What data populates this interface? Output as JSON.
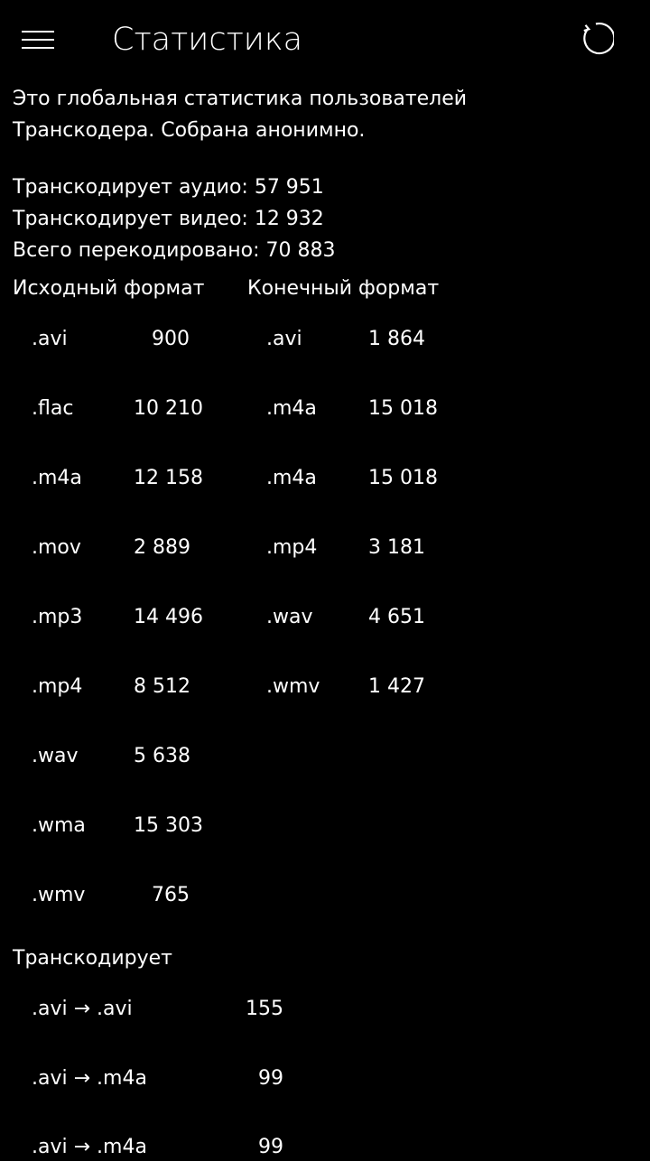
{
  "header": {
    "menu_icon": "hamburger-menu-icon",
    "title": "Статистика",
    "refresh_icon": "refresh-icon"
  },
  "intro": {
    "line1": "Это глобальная статистика пользователей",
    "line2": "Транскодера. Собрана анонимно."
  },
  "totals": {
    "audio": "Транскодирует аудио:  57 951",
    "video": "Транскодирует видео:  12 932",
    "all": "Всего перекодировано:  70 883"
  },
  "formats": {
    "source_header": "Исходный формат",
    "target_header": "Конечный формат",
    "source": [
      {
        "ext": ".avi",
        "count": "900"
      },
      {
        "ext": ".flac",
        "count": "10 210"
      },
      {
        "ext": ".m4a",
        "count": "12 158"
      },
      {
        "ext": ".mov",
        "count": "2 889"
      },
      {
        "ext": ".mp3",
        "count": "14 496"
      },
      {
        "ext": ".mp4",
        "count": "8 512"
      },
      {
        "ext": ".wav",
        "count": "5 638"
      },
      {
        "ext": ".wma",
        "count": "15 303"
      },
      {
        "ext": ".wmv",
        "count": "765"
      }
    ],
    "target": [
      {
        "ext": ".avi",
        "count": "1 864"
      },
      {
        "ext": ".m4a",
        "count": "15 018"
      },
      {
        "ext": ".m4a",
        "count": "15 018"
      },
      {
        "ext": ".mp4",
        "count": "3 181"
      },
      {
        "ext": ".wav",
        "count": "4 651"
      },
      {
        "ext": ".wmv",
        "count": "1 427"
      }
    ]
  },
  "transcodes": {
    "header": "Транскодирует",
    "rows": [
      {
        "pair": ".avi → .avi",
        "count": "155"
      },
      {
        "pair": ".avi → .m4a",
        "count": "99"
      },
      {
        "pair": ".avi → .m4a",
        "count": "99"
      }
    ]
  }
}
